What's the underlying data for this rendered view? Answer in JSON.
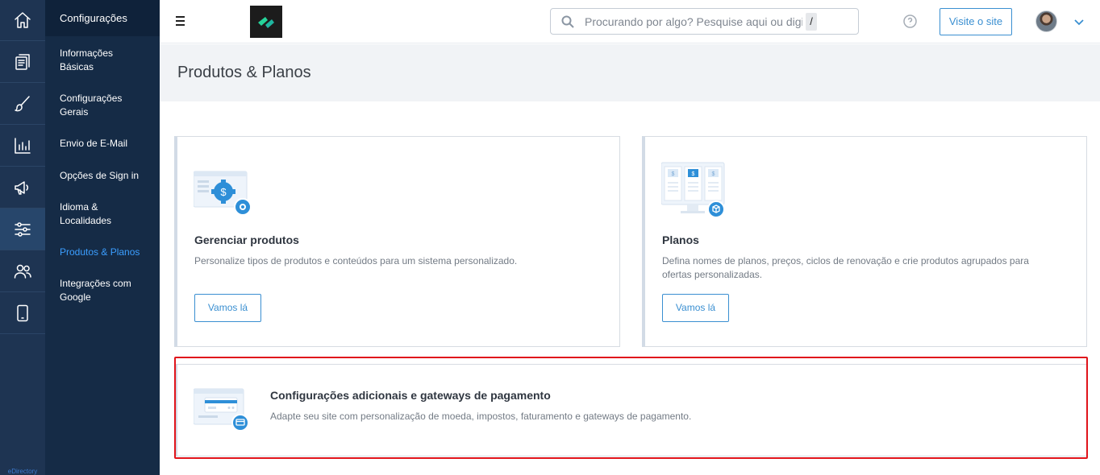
{
  "rail": {
    "items": [
      {
        "icon": "home-icon"
      },
      {
        "icon": "content-pages-icon"
      },
      {
        "icon": "design-brush-icon"
      },
      {
        "icon": "reports-chart-icon"
      },
      {
        "icon": "promotion-megaphone-icon"
      },
      {
        "icon": "settings-sliders-icon",
        "active": true
      },
      {
        "icon": "users-icon"
      },
      {
        "icon": "mobile-icon"
      }
    ],
    "brand": "eDirectory"
  },
  "submenu": {
    "title": "Configurações",
    "items": [
      {
        "label": "Informações Básicas"
      },
      {
        "label": "Configurações Gerais"
      },
      {
        "label": "Envio de E-Mail"
      },
      {
        "label": "Opções de Sign in"
      },
      {
        "label": "Idioma & Localidades"
      },
      {
        "label": "Produtos & Planos",
        "active": true
      },
      {
        "label": "Integrações com Google"
      }
    ]
  },
  "topbar": {
    "search_placeholder": "Procurando por algo? Pesquise aqui ou digite",
    "search_shortcut": "/",
    "visit_label": "Visite o site"
  },
  "page": {
    "title": "Produtos & Planos"
  },
  "cards": {
    "products": {
      "title": "Gerenciar produtos",
      "description": "Personalize tipos de produtos e conteúdos para um sistema personalizado.",
      "button": "Vamos lá"
    },
    "plans": {
      "title": "Planos",
      "description": "Defina nomes de planos, preços, ciclos de renovação e crie produtos agrupados para ofertas personalizadas.",
      "button": "Vamos lá"
    },
    "payments": {
      "title": "Configurações adicionais e gateways de pagamento",
      "description": "Adapte seu site com personalização de moeda, impostos, faturamento e gateways de pagamento."
    }
  },
  "colors": {
    "rail_bg": "#1e3452",
    "submenu_bg": "#152b46",
    "accent": "#3a8fd1",
    "active_link": "#3b9eff",
    "highlight_border": "#e0141b"
  }
}
